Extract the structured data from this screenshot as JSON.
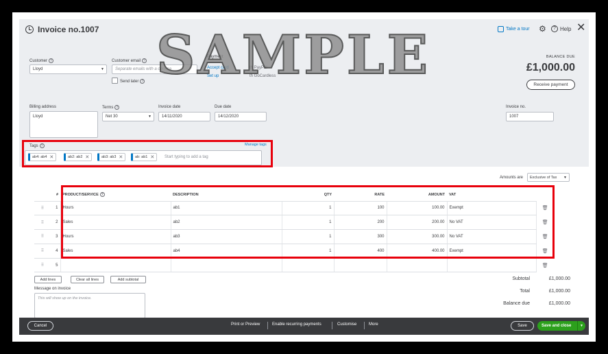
{
  "header": {
    "title": "Invoice no.1007",
    "take_tour": "Take a tour",
    "help": "Help"
  },
  "customer": {
    "label": "Customer",
    "value": "Lloyd",
    "email_label": "Customer email",
    "email_placeholder": "Separate emails with a comma",
    "send_later": "Send later"
  },
  "payment": {
    "label": "Payment",
    "link1": "Accept card",
    "text1": "th PayPal",
    "link2": "Set up",
    "text2": "th GoCardless"
  },
  "balance": {
    "label": "BALANCE DUE",
    "amount": "£1,000.00",
    "receive_button": "Receive payment"
  },
  "billing": {
    "label": "Billing address",
    "value": "Lloyd"
  },
  "terms": {
    "label": "Terms",
    "value": "Net 30"
  },
  "invoice_date": {
    "label": "Invoice date",
    "value": "14/11/2020"
  },
  "due_date": {
    "label": "Due date",
    "value": "14/12/2020"
  },
  "invoice_no": {
    "label": "Invoice no.",
    "value": "1007"
  },
  "tags": {
    "label": "Tags",
    "manage": "Manage tags",
    "items": [
      "ab4: ab4",
      "ab2: ab2",
      "ab3: ab3",
      "ab: ab1"
    ],
    "placeholder": "Start typing to add a tag"
  },
  "amounts_are": {
    "label": "Amounts are",
    "value": "Exclusive of Tax"
  },
  "table": {
    "headers": {
      "num": "#",
      "product": "PRODUCT/SERVICE",
      "description": "DESCRIPTION",
      "qty": "QTY",
      "rate": "RATE",
      "amount": "AMOUNT",
      "vat": "VAT"
    },
    "rows": [
      {
        "num": "1",
        "product": "Hours",
        "description": "ab1",
        "qty": "1",
        "rate": "100",
        "amount": "100.00",
        "vat": "Exempt"
      },
      {
        "num": "2",
        "product": "Sales",
        "description": "ab2",
        "qty": "1",
        "rate": "200",
        "amount": "200.00",
        "vat": "No VAT"
      },
      {
        "num": "3",
        "product": "Hours",
        "description": "ab3",
        "qty": "1",
        "rate": "300",
        "amount": "300.00",
        "vat": "No VAT"
      },
      {
        "num": "4",
        "product": "Sales",
        "description": "ab4",
        "qty": "1",
        "rate": "400",
        "amount": "400.00",
        "vat": "Exempt"
      },
      {
        "num": "5",
        "product": "",
        "description": "",
        "qty": "",
        "rate": "",
        "amount": "",
        "vat": ""
      }
    ]
  },
  "actions": {
    "add_lines": "Add lines",
    "clear_all": "Clear all lines",
    "add_subtotal": "Add subtotal"
  },
  "message": {
    "label": "Message on invoice",
    "placeholder": "This will show up on the invoice."
  },
  "totals": {
    "subtotal_label": "Subtotal",
    "subtotal": "£1,000.00",
    "total_label": "Total",
    "total": "£1,000.00",
    "balance_label": "Balance due",
    "balance": "£1,000.00"
  },
  "footer": {
    "cancel": "Cancel",
    "print_preview": "Print or Preview",
    "recurring": "Enable recurring payments",
    "customise": "Customise",
    "more": "More",
    "save": "Save",
    "save_close": "Save and close"
  },
  "watermark": "SAMPLE",
  "colors": {
    "accent": "#0077c5",
    "primary_green": "#2ca01c",
    "highlight_red": "#e8000b",
    "footer_bg": "#393a3d"
  }
}
